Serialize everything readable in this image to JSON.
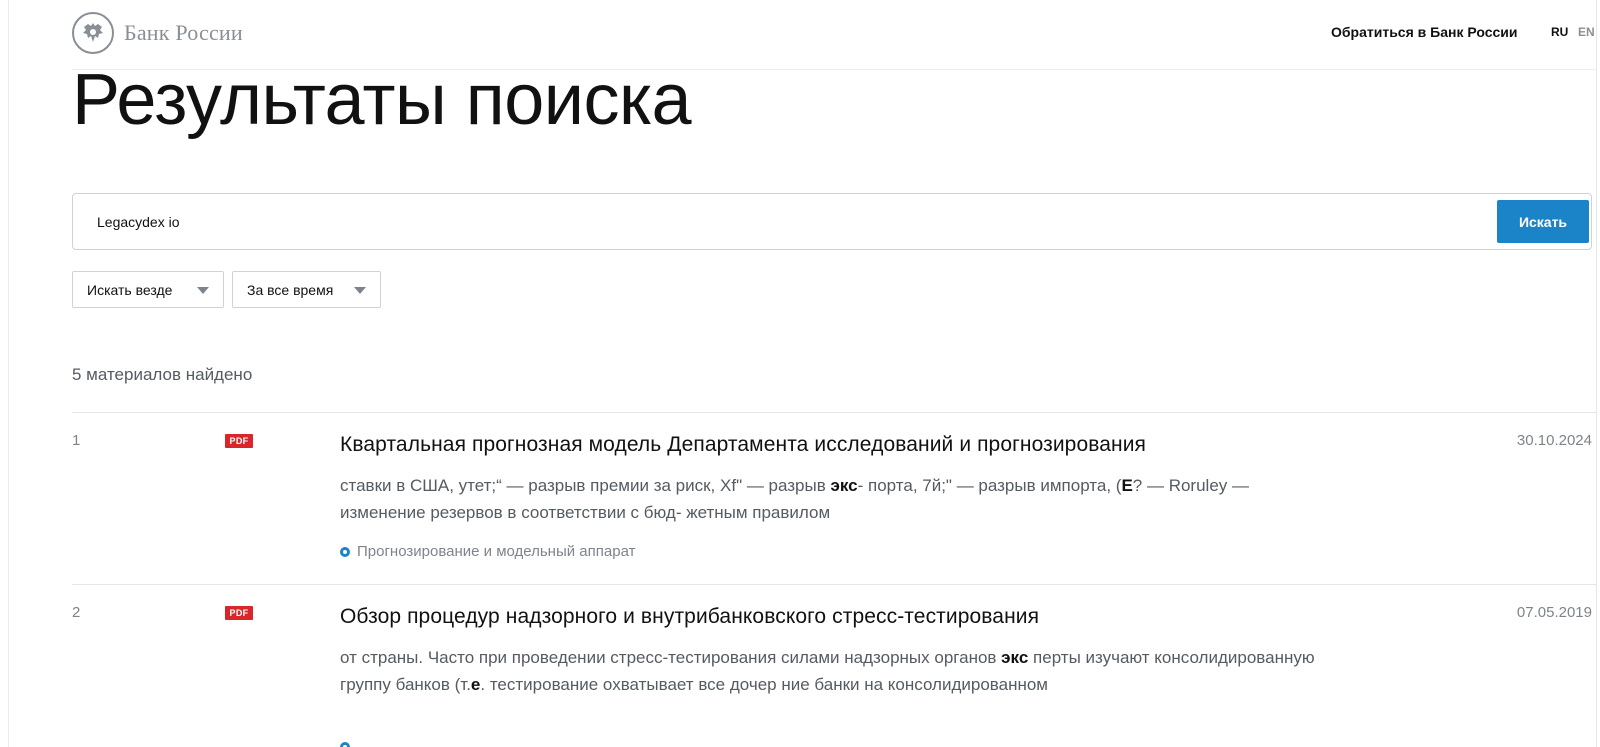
{
  "header": {
    "logo_text": "Банк России",
    "contact_link": "Обратиться в Банк России",
    "lang_ru": "RU",
    "lang_en": "EN"
  },
  "page": {
    "title": "Результаты поиска"
  },
  "search": {
    "value": "Legacydex io",
    "button_label": "Искать"
  },
  "filters": {
    "where": "Искать везде",
    "when": "За все время"
  },
  "results_count": "5 материалов найдено",
  "results": [
    {
      "num": "1",
      "badge": "PDF",
      "title": "Квартальная прогнозная модель Департамента исследований и прогнозирования",
      "date": "30.10.2024",
      "snippet_parts": [
        {
          "t": "ставки в США, утет;“ — разрыв премии за риск, Xf\" — разрыв ",
          "b": false
        },
        {
          "t": "экс",
          "b": true
        },
        {
          "t": "- порта, 7й;\" — разрыв импорта, (",
          "b": false
        },
        {
          "t": "Е",
          "b": true
        },
        {
          "t": "? — Roruley — изменение резервов в соответствии с бюд- жетным правилом",
          "b": false
        }
      ],
      "tag": "Прогнозирование и модельный аппарат"
    },
    {
      "num": "2",
      "badge": "PDF",
      "title": "Обзор процедур надзорного и внутрибанковского стресс-тестирования",
      "date": "07.05.2019",
      "snippet_parts": [
        {
          "t": "от страны. Часто при проведении стресс-тестирования силами надзорных органов ",
          "b": false
        },
        {
          "t": "экс",
          "b": true
        },
        {
          "t": " перты изучают консолидированную группу банков (т.",
          "b": false
        },
        {
          "t": "е",
          "b": true
        },
        {
          "t": ". тестирование охватывает все дочер ние банки на консолидированном",
          "b": false
        }
      ],
      "tag": ""
    }
  ],
  "colors": {
    "accent": "#1b83c8",
    "pdf_badge": "#d8262a",
    "muted_text": "#7e848b"
  }
}
